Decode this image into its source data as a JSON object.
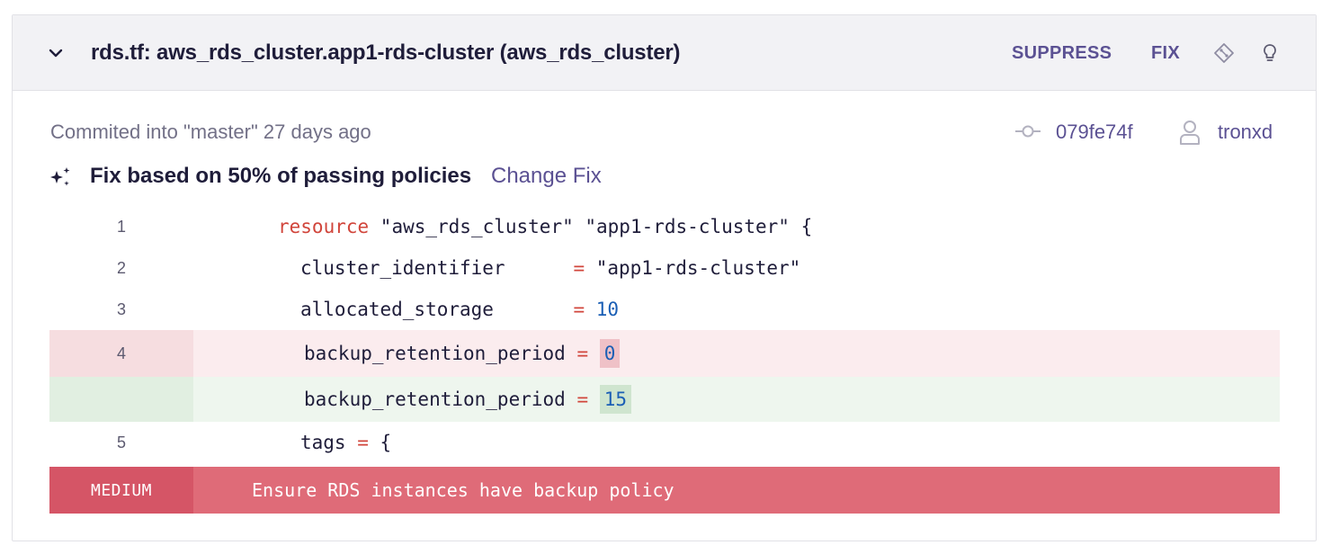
{
  "header": {
    "title": "rds.tf: aws_rds_cluster.app1-rds-cluster (aws_rds_cluster)",
    "suppress_label": "SUPPRESS",
    "fix_label": "FIX"
  },
  "commit": {
    "info": "Commited into \"master\" 27 days ago",
    "hash": "079fe74f",
    "user": "tronxd"
  },
  "fix_banner": {
    "text": "Fix based on 50% of passing policies",
    "change_label": "Change Fix"
  },
  "code": {
    "line1": {
      "num": "1",
      "keyword": "resource",
      "rest": " \"aws_rds_cluster\" \"app1-rds-cluster\" {"
    },
    "line2": {
      "num": "2",
      "key": "cluster_identifier      ",
      "op": "=",
      "value": " \"app1-rds-cluster\""
    },
    "line3": {
      "num": "3",
      "key": "allocated_storage       ",
      "op": "=",
      "value": "10"
    },
    "line4_removed": {
      "num": "4",
      "key": "backup_retention_period ",
      "op": "=",
      "value": "0"
    },
    "line4_added": {
      "num": "",
      "key": "backup_retention_period ",
      "op": "=",
      "value": "15"
    },
    "line5": {
      "num": "5",
      "key": "tags ",
      "op": "=",
      "rest": " {"
    }
  },
  "violation": {
    "severity": "MEDIUM",
    "message": "Ensure RDS instances have backup policy"
  },
  "colors": {
    "accent": "#5b5193",
    "severity_medium": "#df6b78",
    "removed_bg": "#fbecee",
    "added_bg": "#eef6ee"
  },
  "icons": [
    "chevron-down-icon",
    "git-diamond-icon",
    "lightbulb-icon",
    "commit-icon",
    "user-icon",
    "sparkle-icon"
  ]
}
